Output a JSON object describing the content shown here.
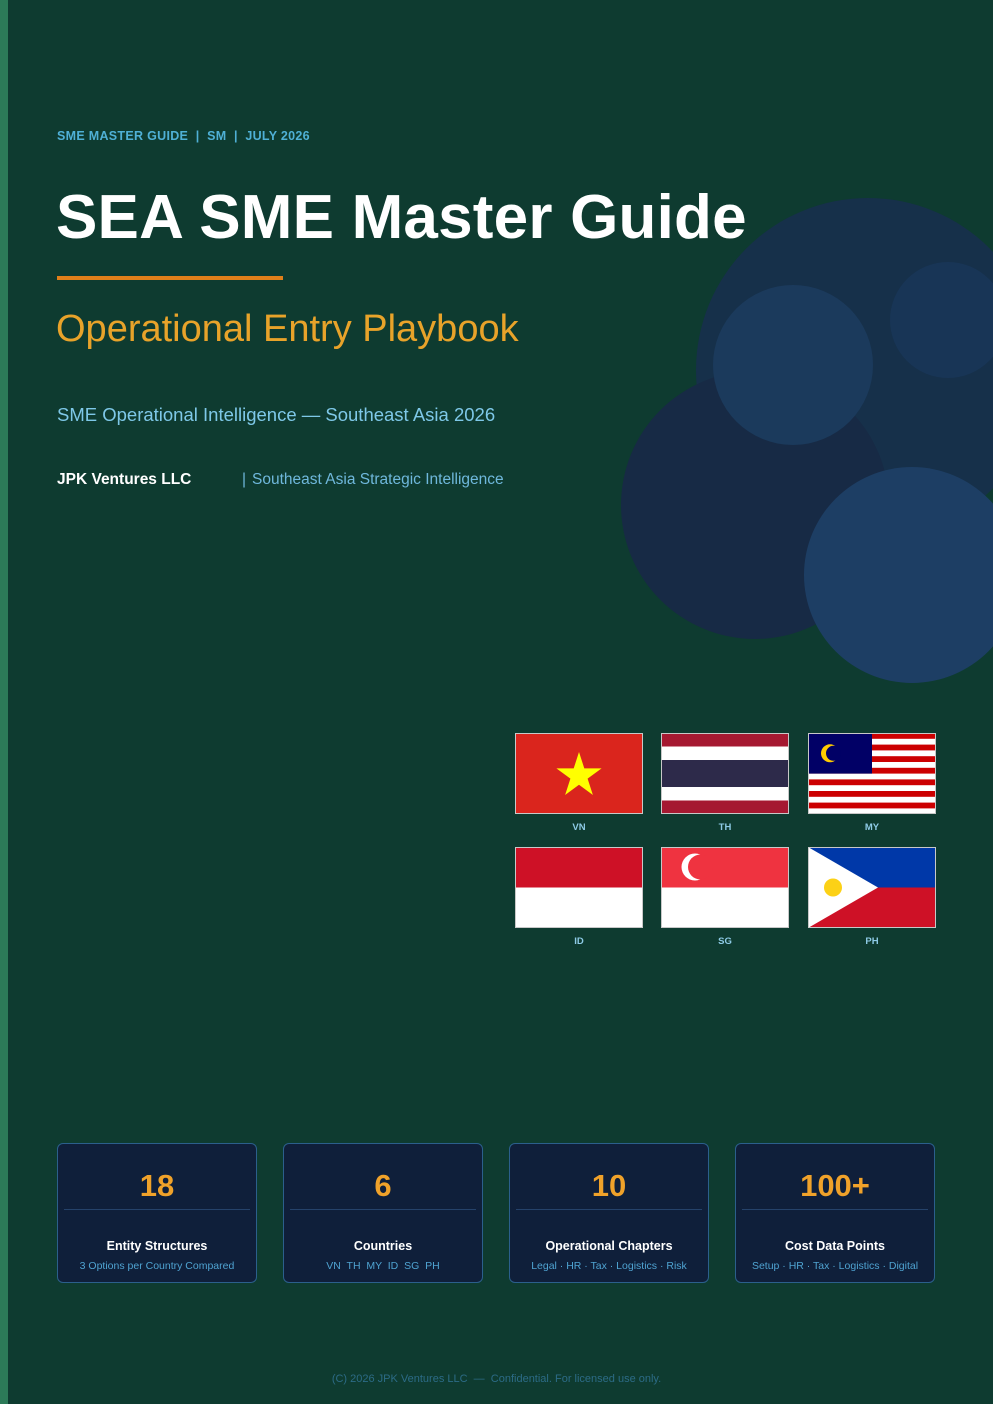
{
  "header": {
    "eyebrow": "SME MASTER GUIDE  |  SM  |  JULY 2026",
    "title": "SEA SME Master Guide",
    "subtitle": "Operational Entry Playbook",
    "tagline": "SME Operational Intelligence — Southeast Asia 2026",
    "company": "JPK Ventures LLC",
    "company_separator": "|",
    "company_tagline": "Southeast Asia Strategic Intelligence"
  },
  "colors": {
    "background": "#0e3b30",
    "accent_orange": "#e07f1a",
    "accent_gold": "#e8a32a",
    "accent_blue": "#4fb0d6",
    "card_background": "#0f1f3a"
  },
  "flags": [
    {
      "code": "VN",
      "icon": "vietnam-flag-icon"
    },
    {
      "code": "TH",
      "icon": "thailand-flag-icon"
    },
    {
      "code": "MY",
      "icon": "malaysia-flag-icon"
    },
    {
      "code": "ID",
      "icon": "indonesia-flag-icon"
    },
    {
      "code": "SG",
      "icon": "singapore-flag-icon"
    },
    {
      "code": "PH",
      "icon": "philippines-flag-icon"
    }
  ],
  "stats": [
    {
      "value": "18",
      "label": "Entity Structures",
      "detail": "3 Options per Country Compared"
    },
    {
      "value": "6",
      "label": "Countries",
      "detail": "VN  TH  MY  ID  SG  PH"
    },
    {
      "value": "10",
      "label": "Operational Chapters",
      "detail": "Legal · HR · Tax · Logistics · Risk"
    },
    {
      "value": "100+",
      "label": "Cost Data Points",
      "detail": "Setup · HR · Tax · Logistics · Digital"
    }
  ],
  "footer": {
    "text": "(C) 2026 JPK Ventures LLC  —  Confidential. For licensed use only."
  }
}
